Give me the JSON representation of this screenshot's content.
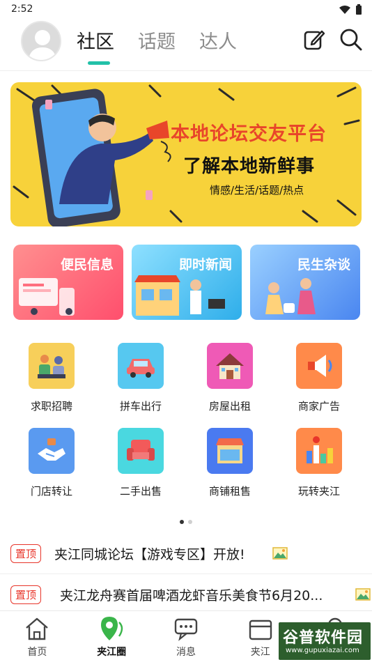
{
  "status": {
    "time": "2:52"
  },
  "header": {
    "tabs": [
      {
        "label": "社区",
        "active": true
      },
      {
        "label": "话题",
        "active": false
      },
      {
        "label": "达人",
        "active": false
      }
    ],
    "accent_color": "#22c1a8"
  },
  "banner": {
    "title": "本地论坛交友平台",
    "subtitle": "了解本地新鲜事",
    "tags": "情感/生活/话题/热点"
  },
  "cards": [
    {
      "label": "便民信息"
    },
    {
      "label": "即时新闻"
    },
    {
      "label": "民生杂谈"
    }
  ],
  "grid": [
    {
      "label": "求职招聘",
      "icon": "job-icon"
    },
    {
      "label": "拼车出行",
      "icon": "car-icon"
    },
    {
      "label": "房屋出租",
      "icon": "house-icon"
    },
    {
      "label": "商家广告",
      "icon": "megaphone-icon"
    },
    {
      "label": "门店转让",
      "icon": "handshake-icon"
    },
    {
      "label": "二手出售",
      "icon": "sofa-icon"
    },
    {
      "label": "商铺租售",
      "icon": "shop-icon"
    },
    {
      "label": "玩转夹江",
      "icon": "city-map-icon"
    }
  ],
  "posts": [
    {
      "badge": "置顶",
      "title": "夹江同城论坛【游戏专区】开放!"
    },
    {
      "badge": "置顶",
      "title": "夹江龙舟赛首届啤酒龙虾音乐美食节6月20..."
    }
  ],
  "bottom_nav": [
    {
      "label": "首页",
      "icon": "home-icon"
    },
    {
      "label": "夹江圈",
      "icon": "location-pin-icon",
      "active": true
    },
    {
      "label": "消息",
      "icon": "chat-icon"
    },
    {
      "label": "夹江",
      "icon": "calendar-icon"
    },
    {
      "label": "",
      "icon": "profile-icon"
    }
  ],
  "watermark": {
    "main": "谷普软件园",
    "sub": "www.gupuxiazai.com"
  }
}
